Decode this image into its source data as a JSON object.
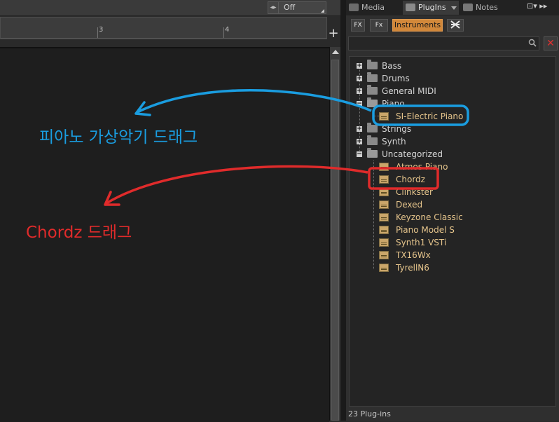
{
  "editor": {
    "snap_value": "Off",
    "ruler_marks": [
      "3",
      "4"
    ]
  },
  "panel": {
    "tabs": [
      {
        "label": "Media",
        "icon": "media-icon"
      },
      {
        "label": "PlugIns",
        "icon": "plugins-icon"
      },
      {
        "label": "Notes",
        "icon": "notes-icon"
      }
    ],
    "tab_controls": "⊡▾ ▸▸",
    "filters": {
      "fx": "FX",
      "pfx": "Fx",
      "instruments": "Instruments"
    },
    "search": {
      "value": "",
      "placeholder": ""
    },
    "tree": [
      {
        "label": "Bass",
        "type": "folder",
        "expanded": false
      },
      {
        "label": "Drums",
        "type": "folder",
        "expanded": false
      },
      {
        "label": "General MIDI",
        "type": "folder",
        "expanded": false
      },
      {
        "label": "Piano",
        "type": "folder",
        "expanded": true
      },
      {
        "label": "SI-Electric Piano",
        "type": "plugin"
      },
      {
        "label": "Strings",
        "type": "folder",
        "expanded": false
      },
      {
        "label": "Synth",
        "type": "folder",
        "expanded": false
      },
      {
        "label": "Uncategorized",
        "type": "folder",
        "expanded": true
      },
      {
        "label": "Atmos Piano",
        "type": "plugin"
      },
      {
        "label": "Chordz",
        "type": "plugin"
      },
      {
        "label": "Clinkster",
        "type": "plugin"
      },
      {
        "label": "Dexed",
        "type": "plugin"
      },
      {
        "label": "Keyzone Classic",
        "type": "plugin"
      },
      {
        "label": "Piano Model S",
        "type": "plugin"
      },
      {
        "label": "Synth1 VSTi",
        "type": "plugin"
      },
      {
        "label": "TX16Wx",
        "type": "plugin"
      },
      {
        "label": "TyrellN6",
        "type": "plugin"
      }
    ],
    "status": "23 Plug-ins"
  },
  "annotations": {
    "blue_text": "피아노 가상악기 드래그",
    "red_text": "Chordz 드래그",
    "blue_color": "#1a9de0",
    "red_color": "#e02b2b"
  }
}
